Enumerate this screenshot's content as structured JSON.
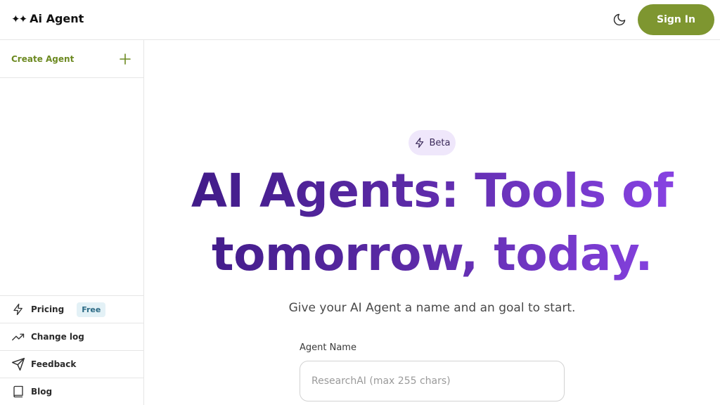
{
  "header": {
    "brand": "Ai Agent",
    "brand_icon": "sparkles-icon",
    "theme_icon": "moon-icon",
    "signin_label": "Sign In"
  },
  "sidebar": {
    "create_label": "Create Agent",
    "create_icon": "plus-icon",
    "items": [
      {
        "label": "Pricing",
        "icon": "lightning-icon",
        "badge": "Free"
      },
      {
        "label": "Change log",
        "icon": "trend-up-icon"
      },
      {
        "label": "Feedback",
        "icon": "send-icon"
      },
      {
        "label": "Blog",
        "icon": "book-icon"
      }
    ]
  },
  "hero": {
    "badge": "Beta",
    "badge_icon": "lightning-icon",
    "headline": "AI Agents: Tools of tomorrow, today.",
    "subtitle": "Give your AI Agent a name and an goal to start."
  },
  "form": {
    "name_label": "Agent Name",
    "name_placeholder": "ResearchAI (max 255 chars)",
    "name_value": ""
  },
  "colors": {
    "accent": "#7e9630",
    "headline_start": "#3f1a86",
    "headline_end": "#8a44e6",
    "beta_bg": "#efe7fb"
  }
}
